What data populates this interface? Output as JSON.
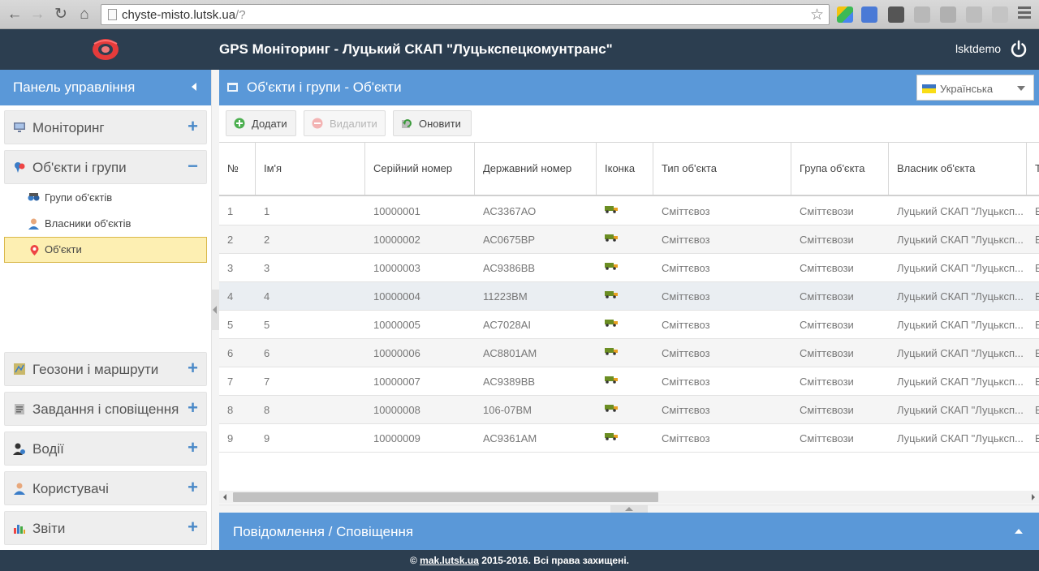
{
  "browser": {
    "url_host": "chyste-misto.lutsk.ua",
    "url_path": "/?"
  },
  "header": {
    "title": "GPS Моніторинг - Луцький СКАП \"Луцькспецкомунтранс\"",
    "username": "lsktdemo"
  },
  "sidebar": {
    "title": "Панель управління",
    "sections": [
      {
        "label": "Моніторинг",
        "toggle": "+"
      },
      {
        "label": "Об'єкти і групи",
        "toggle": "−"
      },
      {
        "label": "Геозони і маршрути",
        "toggle": "+"
      },
      {
        "label": "Завдання і сповіщення",
        "toggle": "+"
      },
      {
        "label": "Водії",
        "toggle": "+"
      },
      {
        "label": "Користувачі",
        "toggle": "+"
      },
      {
        "label": "Звіти",
        "toggle": "+"
      }
    ],
    "sub_items": [
      {
        "label": "Групи об'єктів"
      },
      {
        "label": "Власники об'єктів"
      },
      {
        "label": "Об'єкти"
      }
    ]
  },
  "main": {
    "title": "Об'єкти і групи - Об'єкти",
    "language": "Українська",
    "toolbar": {
      "add": "Додати",
      "delete": "Видалити",
      "refresh": "Оновити"
    },
    "columns": [
      "№",
      "Ім'я",
      "Серійний номер",
      "Державний номер",
      "Іконка",
      "Тип об'єкта",
      "Група об'єкта",
      "Власник об'єкта",
      "Т"
    ],
    "rows": [
      {
        "num": "1",
        "name": "1",
        "serial": "10000001",
        "plate": "АС3367АО",
        "type": "Сміттєвоз",
        "group": "Сміттєвози",
        "owner": "Луцький СКАП \"Луцьксп...",
        "extra": "Е"
      },
      {
        "num": "2",
        "name": "2",
        "serial": "10000002",
        "plate": "АС0675ВР",
        "type": "Сміттєвоз",
        "group": "Сміттєвози",
        "owner": "Луцький СКАП \"Луцьксп...",
        "extra": "Е"
      },
      {
        "num": "3",
        "name": "3",
        "serial": "10000003",
        "plate": "АС9386ВВ",
        "type": "Сміттєвоз",
        "group": "Сміттєвози",
        "owner": "Луцький СКАП \"Луцьксп...",
        "extra": "Е"
      },
      {
        "num": "4",
        "name": "4",
        "serial": "10000004",
        "plate": "11223ВМ",
        "type": "Сміттєвоз",
        "group": "Сміттєвози",
        "owner": "Луцький СКАП \"Луцьксп...",
        "extra": "Е"
      },
      {
        "num": "5",
        "name": "5",
        "serial": "10000005",
        "plate": "АС7028АІ",
        "type": "Сміттєвоз",
        "group": "Сміттєвози",
        "owner": "Луцький СКАП \"Луцьксп...",
        "extra": "Е"
      },
      {
        "num": "6",
        "name": "6",
        "serial": "10000006",
        "plate": "АС8801АМ",
        "type": "Сміттєвоз",
        "group": "Сміттєвози",
        "owner": "Луцький СКАП \"Луцьксп...",
        "extra": "Е"
      },
      {
        "num": "7",
        "name": "7",
        "serial": "10000007",
        "plate": "АС9389ВВ",
        "type": "Сміттєвоз",
        "group": "Сміттєвози",
        "owner": "Луцький СКАП \"Луцьксп...",
        "extra": "Е"
      },
      {
        "num": "8",
        "name": "8",
        "serial": "10000008",
        "plate": "106-07ВМ",
        "type": "Сміттєвоз",
        "group": "Сміттєвози",
        "owner": "Луцький СКАП \"Луцьксп...",
        "extra": "Е"
      },
      {
        "num": "9",
        "name": "9",
        "serial": "10000009",
        "plate": "АС9361АМ",
        "type": "Сміттєвоз",
        "group": "Сміттєвози",
        "owner": "Луцький СКАП \"Луцьксп...",
        "extra": "Е"
      }
    ]
  },
  "notifications": {
    "title": "Повідомлення / Сповіщення"
  },
  "footer": {
    "prefix": "©",
    "link": "mak.lutsk.ua",
    "suffix": "2015-2016. Всі права захищені."
  },
  "colors": {
    "header_bg": "#2c3e50",
    "panel_blue": "#5a98d8",
    "accent_plus": "#4a89c8",
    "active_item_bg": "#fdefb2"
  }
}
